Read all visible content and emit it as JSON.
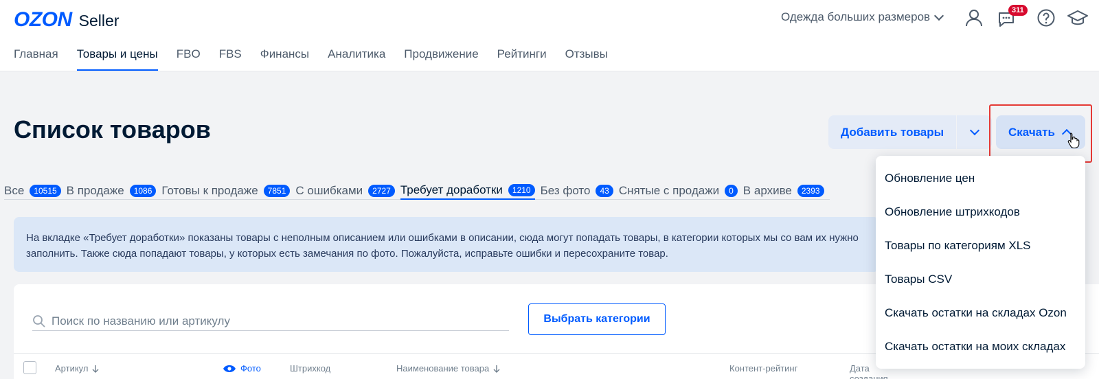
{
  "logo": {
    "brand": "OZON",
    "product": "Seller"
  },
  "header": {
    "store_name": "Одежда больших размеров",
    "messages_badge": "311"
  },
  "nav": {
    "items": [
      {
        "label": "Главная",
        "active": false
      },
      {
        "label": "Товары и цены",
        "active": true
      },
      {
        "label": "FBO",
        "active": false
      },
      {
        "label": "FBS",
        "active": false
      },
      {
        "label": "Финансы",
        "active": false
      },
      {
        "label": "Аналитика",
        "active": false
      },
      {
        "label": "Продвижение",
        "active": false
      },
      {
        "label": "Рейтинги",
        "active": false
      },
      {
        "label": "Отзывы",
        "active": false
      }
    ]
  },
  "page": {
    "title": "Список товаров"
  },
  "actions": {
    "add_label": "Добавить товары",
    "download_label": "Скачать"
  },
  "tabs": [
    {
      "label": "Все",
      "count": "10515"
    },
    {
      "label": "В продаже",
      "count": "1086"
    },
    {
      "label": "Готовы к продаже",
      "count": "7851"
    },
    {
      "label": "С ошибками",
      "count": "2727"
    },
    {
      "label": "Требует доработки",
      "count": "1210"
    },
    {
      "label": "Без фото",
      "count": "43"
    },
    {
      "label": "Снятые с продажи",
      "count": "0"
    },
    {
      "label": "В архиве",
      "count": "2393"
    }
  ],
  "info": {
    "text": "На вкладке «Требует доработки» показаны товары с неполным описанием или ошибками в описании, сюда могут попадать товары, в категории которых мы со вам их нужно заполнить. Также сюда попадают товары, у которых есть замечания по фото. Пожалуйста, исправьте ошибки и пересохраните товар."
  },
  "search": {
    "placeholder": "Поиск по названию или артикулу",
    "value": ""
  },
  "filters": {
    "categories_label": "Выбрать категории"
  },
  "table": {
    "columns": [
      "Артикул",
      "Фото",
      "Штрихкод",
      "Наименование товара",
      "Контент-рейтинг",
      "Дата создания"
    ]
  },
  "download_menu": {
    "items": [
      "Обновление цен",
      "Обновление штрихкодов",
      "Товары по категориям XLS",
      "Товары CSV",
      "Скачать остатки на складах Ozon",
      "Скачать остатки на моих складах"
    ]
  },
  "colors": {
    "brand": "#005bff",
    "badge": "#d70a2e",
    "highlight": "#e53935"
  }
}
